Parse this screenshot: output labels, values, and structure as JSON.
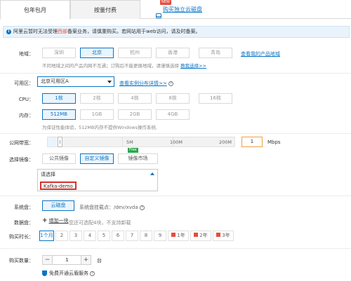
{
  "tabs": [
    {
      "label": "包年包月"
    },
    {
      "label": "按量付费"
    },
    {
      "label": "购买独立云磁盘",
      "badge": "NEW"
    }
  ],
  "notice": {
    "before": "阿里云暂时无法受理",
    "highlight": "西部",
    "after": "备案业务，请慎重购买。若网站用于web访问，请及时备案。"
  },
  "region": {
    "label": "地域：",
    "options": [
      "深圳",
      "北京",
      "杭州",
      "香港",
      "青岛"
    ],
    "selected": "北京",
    "link": "查看我的产品地域",
    "hint_before": "不同地域之间的产品内网不互通；订购后不能更换地域，请谨慎选择",
    "hint_link": "教我选择>>"
  },
  "zone": {
    "label": "可用区：",
    "value": "北京可用区A",
    "link": "查看实例分布详情>>"
  },
  "cpu": {
    "label": "CPU：",
    "options": [
      "1核",
      "2核",
      "4核",
      "8核",
      "16核"
    ],
    "selected": "1核"
  },
  "memory": {
    "label": "内存：",
    "options": [
      "512MB",
      "1GB",
      "2GB",
      "4GB"
    ],
    "selected": "512MB",
    "hint": "为保证性能体验，512MB内存不提供Windows操作系统."
  },
  "bandwidth": {
    "label": "公网带宽：",
    "ticks": [
      "5M",
      "100M",
      "200M"
    ],
    "value": "1",
    "unit": "Mbps",
    "level": 1
  },
  "image": {
    "label": "选择镜像：",
    "options": [
      "公共镜像",
      "自定义镜像",
      "镜像市场"
    ],
    "selected": "自定义镜像",
    "free_badge": "Free",
    "dropdown_placeholder": "请选择",
    "dropdown_item": "Kafka-demo"
  },
  "system_disk": {
    "label": "系统盘：",
    "value": "云磁盘",
    "hint": "系统盘挂载点：/dev/xvda"
  },
  "data_disk": {
    "label": "数据盘：",
    "add_label": "增加一块",
    "hint": "您还可选配4块，不支持卸载"
  },
  "duration": {
    "label": "购买时长：",
    "months": [
      "1个月",
      "2",
      "3",
      "4",
      "5",
      "6",
      "7",
      "8",
      "9"
    ],
    "years": [
      "1年",
      "2年",
      "3年"
    ],
    "selected": "1个月"
  },
  "quantity": {
    "label": "购买数量：",
    "minus": "−",
    "value": "1",
    "plus": "+",
    "unit": "台"
  },
  "security": {
    "label": "免费开通云盾服务"
  },
  "colors": {
    "accent": "#0a74c4",
    "danger": "#d9302c"
  }
}
